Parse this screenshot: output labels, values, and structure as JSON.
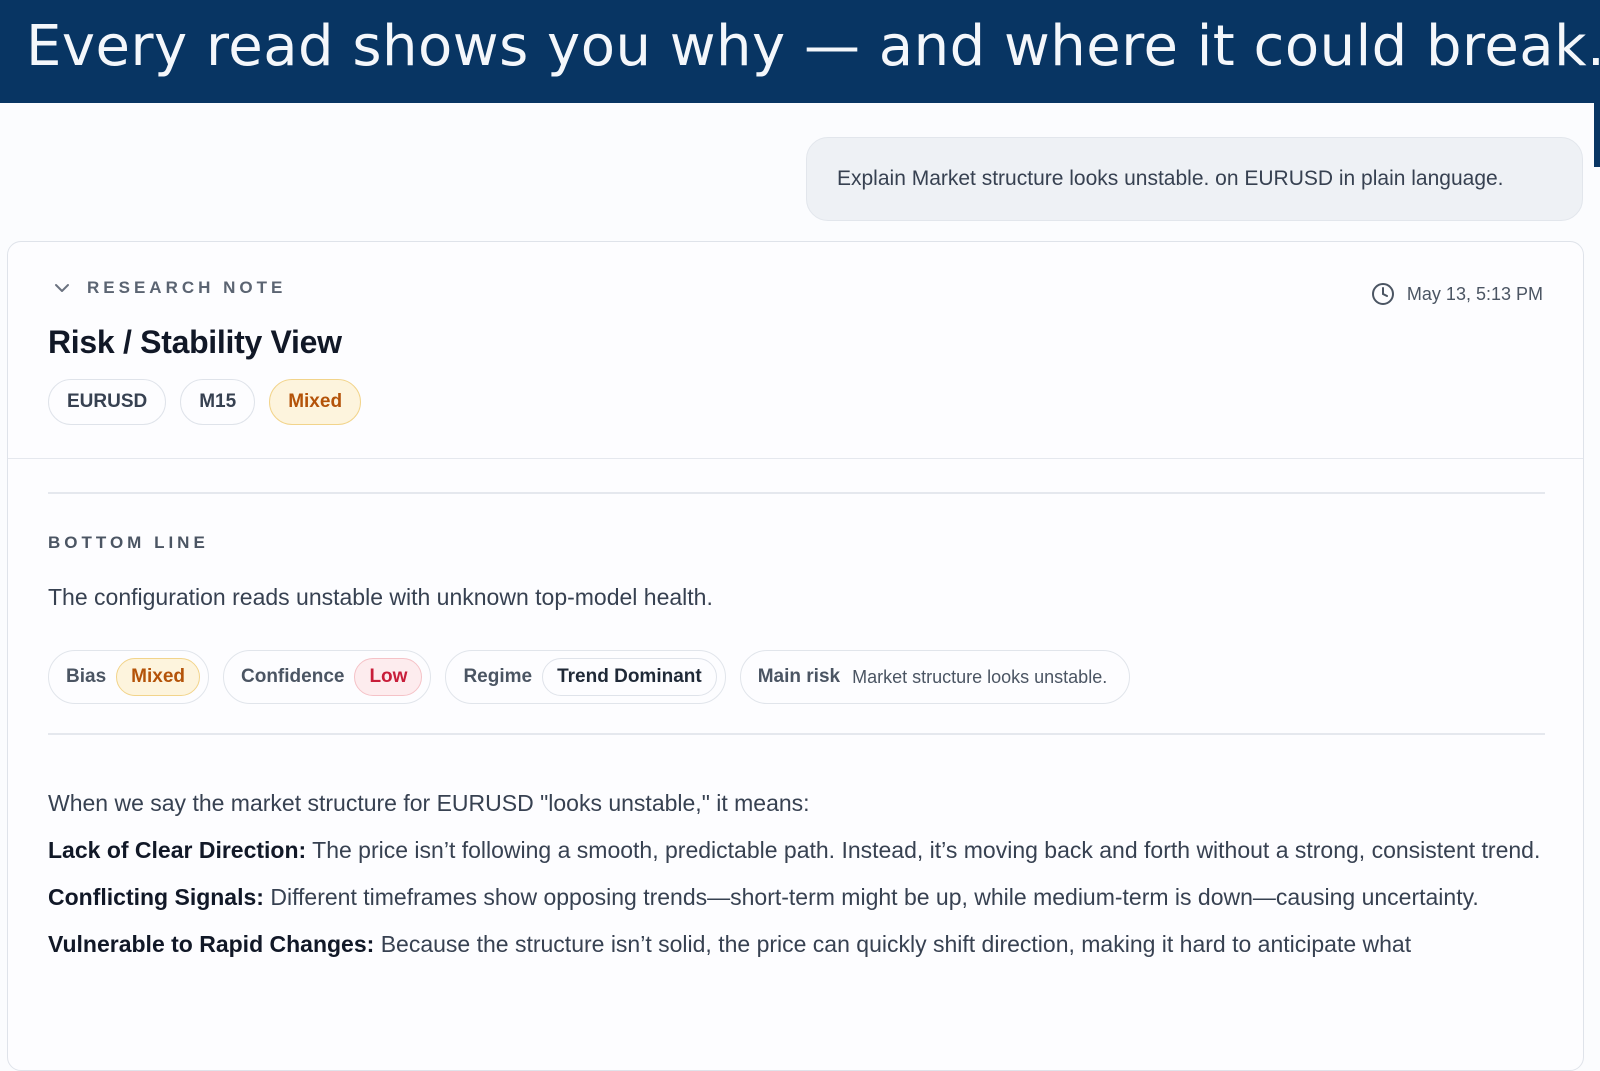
{
  "banner": {
    "text": "Every read shows you why — and where it could break."
  },
  "user_message": "Explain Market structure looks unstable. on EURUSD in plain language.",
  "note": {
    "eyebrow": "RESEARCH NOTE",
    "timestamp": "May 13, 5:13 PM",
    "title": "Risk / Stability View",
    "tags": [
      "EURUSD",
      "M15",
      "Mixed"
    ]
  },
  "bottom_line": {
    "label": "BOTTOM LINE",
    "text": "The configuration reads unstable with unknown top-model health."
  },
  "metrics": {
    "bias": {
      "key": "Bias",
      "value": "Mixed"
    },
    "confidence": {
      "key": "Confidence",
      "value": "Low"
    },
    "regime": {
      "key": "Regime",
      "value": "Trend Dominant"
    },
    "main_risk": {
      "key": "Main risk",
      "value": "Market structure looks unstable."
    }
  },
  "explanation": {
    "intro": "When we say the market structure for EURUSD \"looks unstable,\" it means:",
    "points": [
      {
        "term": "Lack of Clear Direction:",
        "text": " The price isn’t following a smooth, predictable path. Instead, it’s moving back and forth without a strong, consistent trend."
      },
      {
        "term": "Conflicting Signals:",
        "text": " Different timeframes show opposing trends—short-term might be up, while medium-term is down—causing uncertainty."
      },
      {
        "term": "Vulnerable to Rapid Changes:",
        "text": " Because the structure isn’t solid, the price can quickly shift direction, making it hard to anticipate what"
      }
    ]
  },
  "colors": {
    "banner": "#083563",
    "mixed": "#b45309",
    "low": "#c81e3a"
  }
}
